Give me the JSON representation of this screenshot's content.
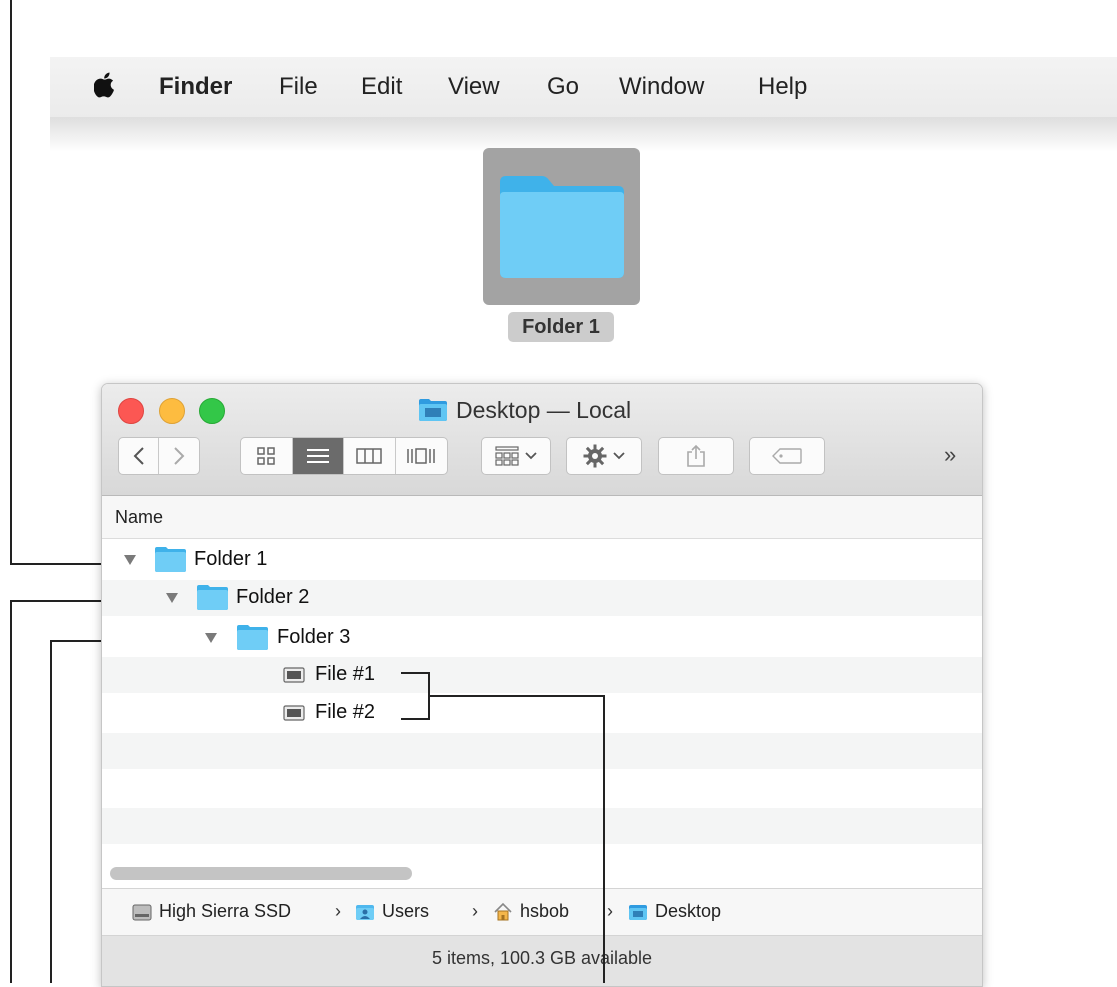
{
  "menubar": {
    "apple_icon": "apple-logo-icon",
    "items": [
      "Finder",
      "File",
      "Edit",
      "View",
      "Go",
      "Window",
      "Help"
    ]
  },
  "desktop": {
    "folder_label": "Folder 1",
    "folder_icon": "folder-icon",
    "selected": true
  },
  "window": {
    "title": "Desktop — Local",
    "title_icon": "desktop-folder-icon",
    "toolbar": {
      "nav": [
        "back-chevron-icon",
        "forward-chevron-icon"
      ],
      "view_modes": [
        "icon-view-icon",
        "list-view-icon",
        "column-view-icon",
        "cover-flow-icon"
      ],
      "active_view": "list",
      "group_menu_icon": "group-by-icon",
      "action_menu_icon": "gear-icon",
      "share_icon": "share-icon",
      "tag_icon": "tag-icon",
      "overflow": "»"
    },
    "column_header": "Name",
    "rows": [
      {
        "label": "Folder 1",
        "type": "folder",
        "expanded": true
      },
      {
        "label": "Folder 2",
        "type": "folder",
        "expanded": true
      },
      {
        "label": "Folder 3",
        "type": "folder",
        "expanded": true
      },
      {
        "label": "File #1",
        "type": "file"
      },
      {
        "label": "File #2",
        "type": "file"
      }
    ],
    "path": [
      {
        "label": "High Sierra SSD",
        "icon": "hard-drive-icon"
      },
      {
        "label": "Users",
        "icon": "users-folder-icon"
      },
      {
        "label": "hsbob",
        "icon": "home-icon"
      },
      {
        "label": "Desktop",
        "icon": "desktop-folder-icon"
      }
    ],
    "path_separator": "›",
    "status": "5 items, 100.3 GB available"
  },
  "colors": {
    "folder_blue": "#5fc5f3",
    "close": "#fc5753",
    "minimize": "#fdbc40",
    "zoom": "#33c748"
  }
}
